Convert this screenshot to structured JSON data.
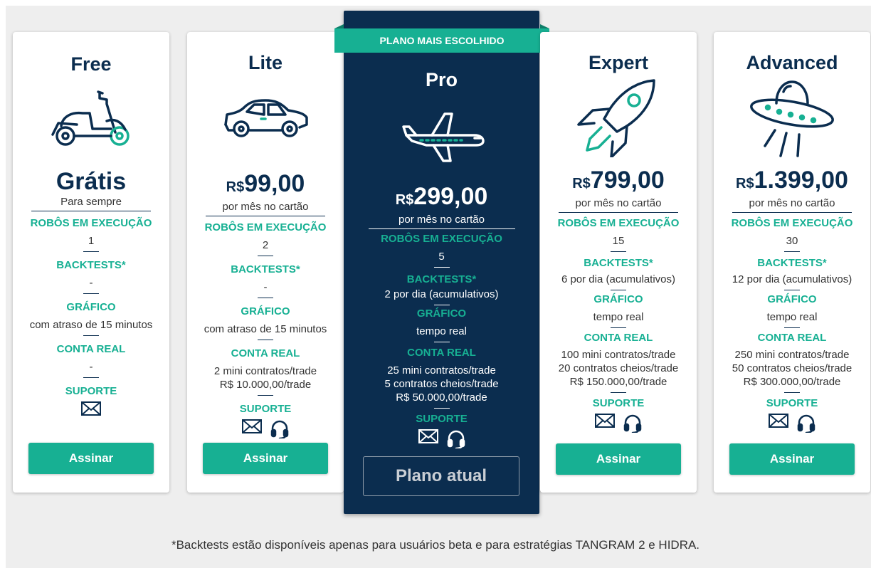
{
  "colors": {
    "navy": "#0b2d4f",
    "teal": "#17b093",
    "bg": "#eeeeee"
  },
  "labels": {
    "robots": "ROBÔS EM EXECUÇÃO",
    "backtests": "BACKTESTS*",
    "chart": "GRÁFICO",
    "real_account": "CONTA REAL",
    "support": "SUPORTE"
  },
  "ribbon": "PLANO MAIS ESCOLHIDO",
  "plans": [
    {
      "name": "Free",
      "icon": "scooter-icon",
      "price_text": "Grátis",
      "price_sub": "Para sempre",
      "robots": "1",
      "backtests": "-",
      "chart": "com atraso de 15 minutos",
      "real_account": [
        "-"
      ],
      "support_icons": [
        "email-icon"
      ],
      "button": "Assinar"
    },
    {
      "name": "Lite",
      "icon": "car-icon",
      "currency": "R$",
      "price": "99,00",
      "price_sub": "por mês no cartão",
      "robots": "2",
      "backtests": "-",
      "chart": "com atraso de 15 minutos",
      "real_account": [
        "2 mini contratos/trade",
        "R$ 10.000,00/trade"
      ],
      "support_icons": [
        "email-icon",
        "headset-icon"
      ],
      "button": "Assinar"
    },
    {
      "name": "Pro",
      "icon": "airplane-icon",
      "currency": "R$",
      "price": "299,00",
      "price_sub": "por mês no cartão",
      "robots": "5",
      "backtests": "2 por dia (acumulativos)",
      "chart": "tempo real",
      "real_account": [
        "25 mini contratos/trade",
        "5 contratos cheios/trade",
        "R$ 50.000,00/trade"
      ],
      "support_icons": [
        "email-icon",
        "headset-icon"
      ],
      "button": "Plano atual"
    },
    {
      "name": "Expert",
      "icon": "rocket-icon",
      "currency": "R$",
      "price": "799,00",
      "price_sub": "por mês no cartão",
      "robots": "15",
      "backtests": "6 por dia (acumulativos)",
      "chart": "tempo real",
      "real_account": [
        "100 mini contratos/trade",
        "20 contratos cheios/trade",
        "R$ 150.000,00/trade"
      ],
      "support_icons": [
        "email-icon",
        "headset-icon"
      ],
      "button": "Assinar"
    },
    {
      "name": "Advanced",
      "icon": "ufo-icon",
      "currency": "R$",
      "price": "1.399,00",
      "price_sub": "por mês no cartão",
      "robots": "30",
      "backtests": "12 por dia (acumulativos)",
      "chart": "tempo real",
      "real_account": [
        "250 mini contratos/trade",
        "50 contratos cheios/trade",
        "R$ 300.000,00/trade"
      ],
      "support_icons": [
        "email-icon",
        "headset-icon"
      ],
      "button": "Assinar"
    }
  ],
  "footnote": "*Backtests estão disponíveis apenas para usuários beta e para estratégias TANGRAM 2 e HIDRA."
}
